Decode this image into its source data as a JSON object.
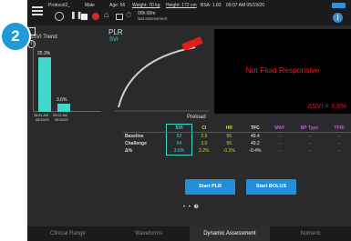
{
  "step_badge": "2",
  "header": {
    "patient_id": "Protocol2_",
    "sex": "Male",
    "age": "Age: 56",
    "weight": "Weight: 70 kg",
    "height": "Height: 172 cm",
    "bsa": "BSA: 1.83",
    "datetime": "09:07 AM  05/19/20",
    "elapsed": "00h:00m",
    "last_assessment": "last assessment"
  },
  "trend": {
    "title": "ΔSVI Trend",
    "bars": [
      {
        "label": "25.3%",
        "value": 25.3,
        "time": "08:51 AM",
        "date": "05/19/20"
      },
      {
        "label": "3.6%",
        "value": 3.6,
        "time": "09:02 AM",
        "date": "05/19/20"
      }
    ],
    "color": "#40d9c8"
  },
  "plr": {
    "title": "PLR",
    "subtitle": "SVI",
    "xlabel": "Preload",
    "curve_color": "#cccccc",
    "marker_color": "#e81a1a"
  },
  "response": {
    "message": "Not Fluid Responsive",
    "delta": "ΔSVI = 3.6%",
    "color": "#e02020"
  },
  "table": {
    "headers": [
      "",
      "SVI",
      "CI",
      "HR",
      "TFC",
      "MAP",
      "BP Type",
      "TPRI"
    ],
    "rows": [
      {
        "label": "Baseline",
        "values": [
          "52",
          "2.9",
          "56",
          "49.4",
          "--",
          "--",
          "--"
        ]
      },
      {
        "label": "Challenge",
        "values": [
          "54",
          "3.0",
          "56",
          "49.2",
          "--",
          "--",
          "--"
        ]
      },
      {
        "label": "Δ%",
        "values": [
          "3.6%",
          "2.2%",
          "-0.3%",
          "-0.4%",
          "--",
          "--",
          "--"
        ]
      }
    ]
  },
  "buttons": {
    "start_plr": "Start PLR",
    "start_bolus": "Start BOLUS"
  },
  "pager": {
    "dots": "• • ",
    "current": "❸"
  },
  "tabs": [
    "Clinical Range",
    "Waveforms",
    "Dynamic Assessment",
    "Numeric"
  ],
  "active_tab": "Dynamic Assessment",
  "accent_color": "#1f8fd9"
}
